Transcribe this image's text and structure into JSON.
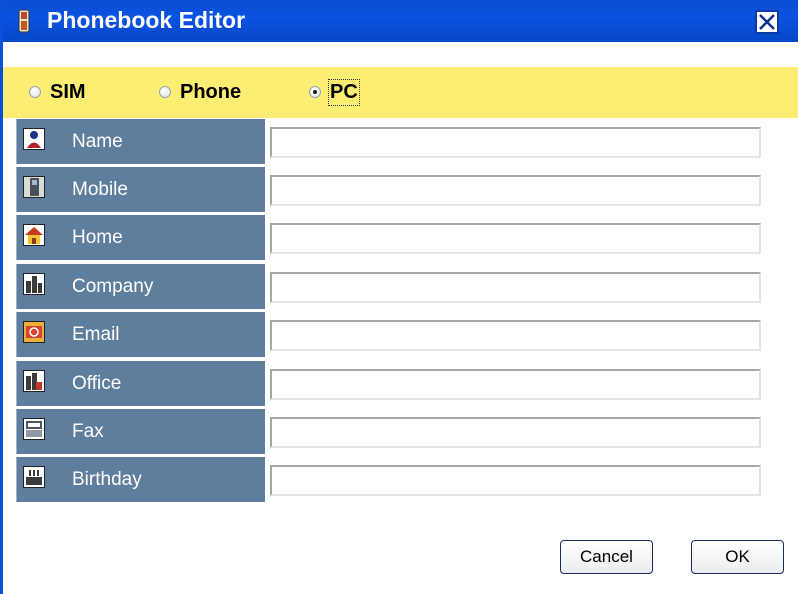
{
  "window": {
    "title": "Phonebook Editor"
  },
  "source": {
    "options": [
      {
        "label": "SIM",
        "selected": false
      },
      {
        "label": "Phone",
        "selected": false
      },
      {
        "label": "PC",
        "selected": true
      }
    ]
  },
  "fields": [
    {
      "label": "Name",
      "icon": "person-icon",
      "value": ""
    },
    {
      "label": "Mobile",
      "icon": "mobile-phone-icon",
      "value": ""
    },
    {
      "label": "Home",
      "icon": "house-icon",
      "value": ""
    },
    {
      "label": "Company",
      "icon": "company-building-icon",
      "value": ""
    },
    {
      "label": "Email",
      "icon": "email-icon",
      "value": ""
    },
    {
      "label": "Office",
      "icon": "office-building-icon",
      "value": ""
    },
    {
      "label": "Fax",
      "icon": "fax-icon",
      "value": ""
    },
    {
      "label": "Birthday",
      "icon": "birthday-cake-icon",
      "value": ""
    }
  ],
  "buttons": {
    "cancel": "Cancel",
    "ok": "OK"
  },
  "colors": {
    "title_bar": "#0a4ed0",
    "source_bar": "#fbee72",
    "label_cell": "#5e7e9d"
  }
}
